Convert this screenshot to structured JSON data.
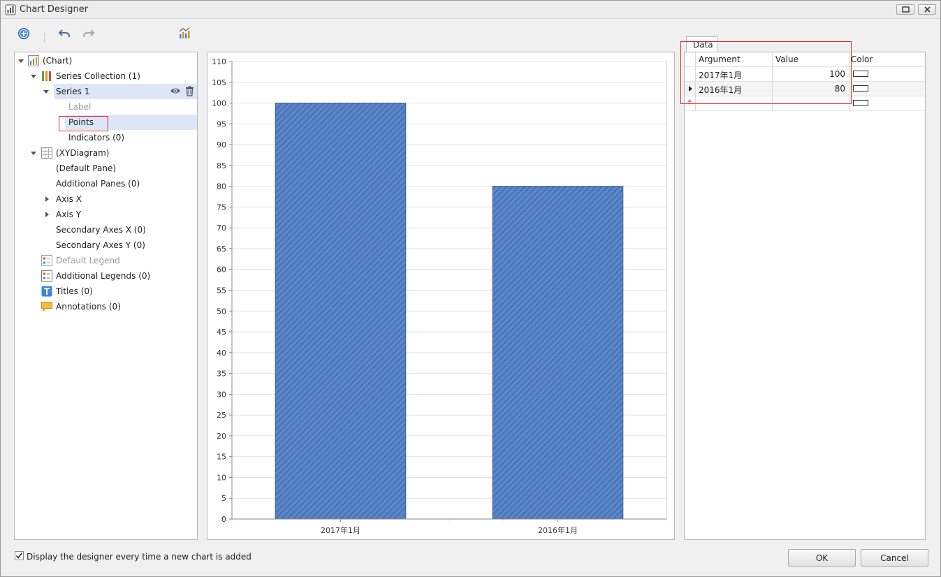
{
  "window": {
    "title": "Chart Designer"
  },
  "toolbar": {
    "icons": [
      "add-icon",
      "undo-icon",
      "redo-icon",
      "chart-wizard-icon"
    ]
  },
  "tree": {
    "items": [
      {
        "label": "(Chart)",
        "icon": "chart-icon"
      },
      {
        "label": "Series Collection (1)",
        "icon": "series-collection-icon"
      },
      {
        "label": "Series 1"
      },
      {
        "label": "Label"
      },
      {
        "label": "Points"
      },
      {
        "label": "Indicators (0)"
      },
      {
        "label": "(XYDiagram)",
        "icon": "diagram-icon"
      },
      {
        "label": "(Default Pane)"
      },
      {
        "label": "Additional Panes (0)"
      },
      {
        "label": "Axis X"
      },
      {
        "label": "Axis Y"
      },
      {
        "label": "Secondary Axes X (0)"
      },
      {
        "label": "Secondary Axes Y (0)"
      },
      {
        "label": "Default Legend",
        "icon": "legend-icon"
      },
      {
        "label": "Additional Legends (0)",
        "icon": "legend-icon"
      },
      {
        "label": "Titles (0)",
        "icon": "title-icon"
      },
      {
        "label": "Annotations (0)",
        "icon": "annotation-icon"
      }
    ]
  },
  "chart_data": {
    "type": "bar",
    "categories": [
      "2017年1月",
      "2016年1月"
    ],
    "values": [
      100,
      80
    ],
    "ylim": [
      0,
      110
    ],
    "ytick_step": 5,
    "grid": true,
    "bar_color": "#5b87c8",
    "bar_fill": "diagonal-stripes"
  },
  "data_panel": {
    "tab": "Data",
    "columns": [
      "Argument",
      "Value",
      "Color"
    ],
    "rows": [
      {
        "argument": "2017年1月",
        "value": "100"
      },
      {
        "argument": "2016年1月",
        "value": "80"
      }
    ],
    "new_row_marker": "*"
  },
  "footer": {
    "checkbox_label": "Display the designer every time a new chart is added",
    "checkbox_checked": true,
    "ok": "OK",
    "cancel": "Cancel"
  },
  "colors": {
    "accent": "#4a7fc8",
    "selection": "#dce6f7",
    "highlight_box": "#e0232a"
  }
}
